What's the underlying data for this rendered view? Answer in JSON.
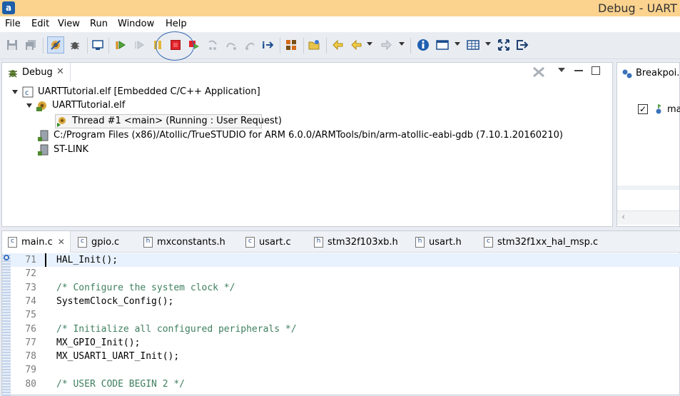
{
  "window": {
    "title": "Debug - UART",
    "app_icon": "a"
  },
  "menu": [
    "File",
    "Edit",
    "View",
    "Run",
    "Window",
    "Help"
  ],
  "toolbar": {
    "icons": [
      "save-icon",
      "save-all-icon",
      "skip-breakpoints-icon",
      "debug-icon",
      "terminal-icon",
      "resume-icon",
      "step-return-icon",
      "suspend-icon",
      "terminate-icon",
      "restart-icon",
      "step-into-icon",
      "step-over-icon",
      "step-return-icon",
      "instruction-step-icon",
      "registers-icon",
      "open-folder-icon",
      "back-icon",
      "forward-icon",
      "info-icon",
      "window-icon",
      "grid-icon",
      "maximize-icon",
      "exit-icon"
    ],
    "highlight_color": "#3a6ab3"
  },
  "debug": {
    "tab_label": "Debug",
    "rows": [
      {
        "label": "UARTTutorial.elf [Embedded C/C++ Application]",
        "icon": "c-launch-icon"
      },
      {
        "label": "UARTTutorial.elf",
        "icon": "process-icon"
      },
      {
        "label": "Thread #1 <main> (Running : User Request)",
        "icon": "thread-running-icon"
      },
      {
        "label": "C:/Program Files (x86)/Atollic/TrueSTUDIO for ARM 6.0.0/ARMTools/bin/arm-atollic-eabi-gdb (7.10.1.20160210)",
        "icon": "gdb-icon"
      },
      {
        "label": "ST-LINK",
        "icon": "stlink-icon"
      }
    ]
  },
  "breakpoints": {
    "tab_label": "Breakpoi...",
    "item_label": "ma",
    "checked": true
  },
  "editor": {
    "tabs": [
      {
        "label": "main.c",
        "kind": "c",
        "active": true,
        "closable": true
      },
      {
        "label": "gpio.c",
        "kind": "c"
      },
      {
        "label": "mxconstants.h",
        "kind": "h"
      },
      {
        "label": "usart.c",
        "kind": "c"
      },
      {
        "label": "stm32f103xb.h",
        "kind": "h"
      },
      {
        "label": "usart.h",
        "kind": "h"
      },
      {
        "label": "stm32f1xx_hal_msp.c",
        "kind": "c"
      }
    ],
    "lines": [
      {
        "num": "71",
        "text": "HAL_Init();",
        "type": "code",
        "current": true
      },
      {
        "num": "72",
        "text": "",
        "type": "code"
      },
      {
        "num": "73",
        "text": "/* Configure the system clock */",
        "type": "comment"
      },
      {
        "num": "74",
        "text": "SystemClock_Config();",
        "type": "code"
      },
      {
        "num": "75",
        "text": "",
        "type": "code"
      },
      {
        "num": "76",
        "text": "/* Initialize all configured peripherals */",
        "type": "comment"
      },
      {
        "num": "77",
        "text": "MX_GPIO_Init();",
        "type": "code"
      },
      {
        "num": "78",
        "text": "MX_USART1_UART_Init();",
        "type": "code"
      },
      {
        "num": "79",
        "text": "",
        "type": "code"
      },
      {
        "num": "80",
        "text": "/* USER CODE BEGIN 2 */",
        "type": "comment"
      }
    ]
  },
  "colors": {
    "titlebar": "#fbd38f",
    "comment": "#3f7f5f",
    "terminate": "#e2232a",
    "current_line": "#e8f2fe"
  }
}
